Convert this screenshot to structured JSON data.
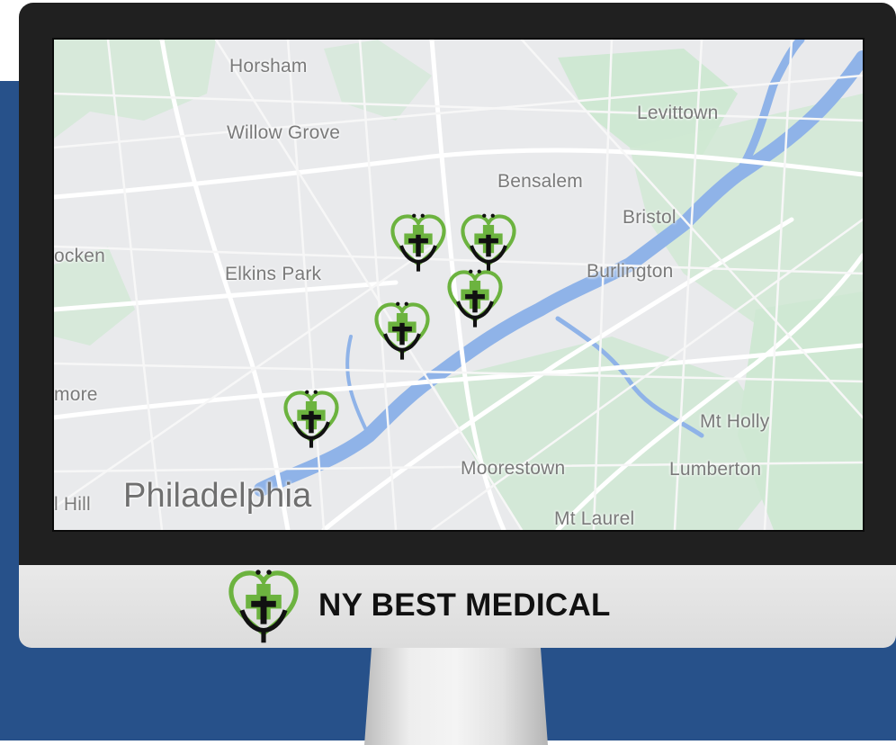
{
  "map": {
    "places": [
      {
        "id": "horsham",
        "name": "Horsham"
      },
      {
        "id": "levittown",
        "name": "Levittown"
      },
      {
        "id": "willow-grove",
        "name": "Willow Grove"
      },
      {
        "id": "bensalem",
        "name": "Bensalem"
      },
      {
        "id": "bristol",
        "name": "Bristol"
      },
      {
        "id": "conshohocken",
        "name": "ocken"
      },
      {
        "id": "elkins-park",
        "name": "Elkins Park"
      },
      {
        "id": "burlington",
        "name": "Burlington"
      },
      {
        "id": "ardmore",
        "name": "more"
      },
      {
        "id": "mt-holly",
        "name": "Mt Holly"
      },
      {
        "id": "moorestown",
        "name": "Moorestown"
      },
      {
        "id": "lumberton",
        "name": "Lumberton"
      },
      {
        "id": "philadelphia",
        "name": "Philadelphia"
      },
      {
        "id": "chestnut-hill",
        "name": "l Hill"
      },
      {
        "id": "mt-laurel",
        "name": "Mt Laurel"
      }
    ],
    "marker_count": 5
  },
  "brand": {
    "name": "NY BEST MEDICAL"
  },
  "colors": {
    "background_blue": "#27518a",
    "bezel": "#202020",
    "chin": "#e4e4e4",
    "map_land": "#e9eaec",
    "map_park": "#cfe8d3",
    "map_water": "#8fb3e8",
    "map_road": "#ffffff",
    "logo_green": "#6cb33f",
    "logo_dark": "#111111"
  },
  "icons": {
    "marker": "heart-medical-pin-icon",
    "logo": "heart-cross-stethoscope-icon"
  }
}
